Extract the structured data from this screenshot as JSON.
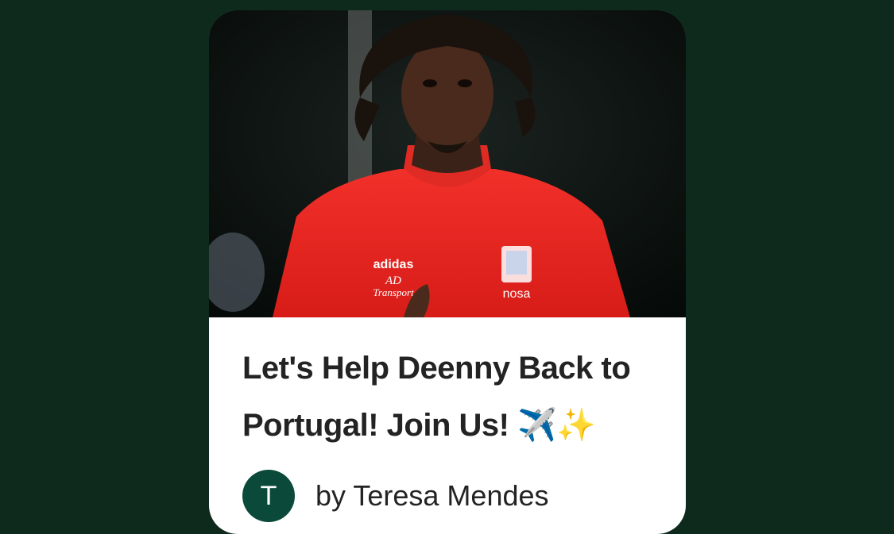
{
  "card": {
    "image_alt": "Football player in red training top",
    "shirt_sponsor": "adidas AD Transport",
    "shirt_badge_text": "nosa",
    "title": "Let's Help Deenny Back to Portugal! Join Us! ✈️✨",
    "author_initial": "T",
    "author_byline": "by Teresa Mendes"
  },
  "colors": {
    "page_background": "#0e2a1c",
    "card_background": "#ffffff",
    "avatar_background": "#0b4a3a",
    "shirt_red": "#e8231f",
    "title_text": "#232323"
  }
}
